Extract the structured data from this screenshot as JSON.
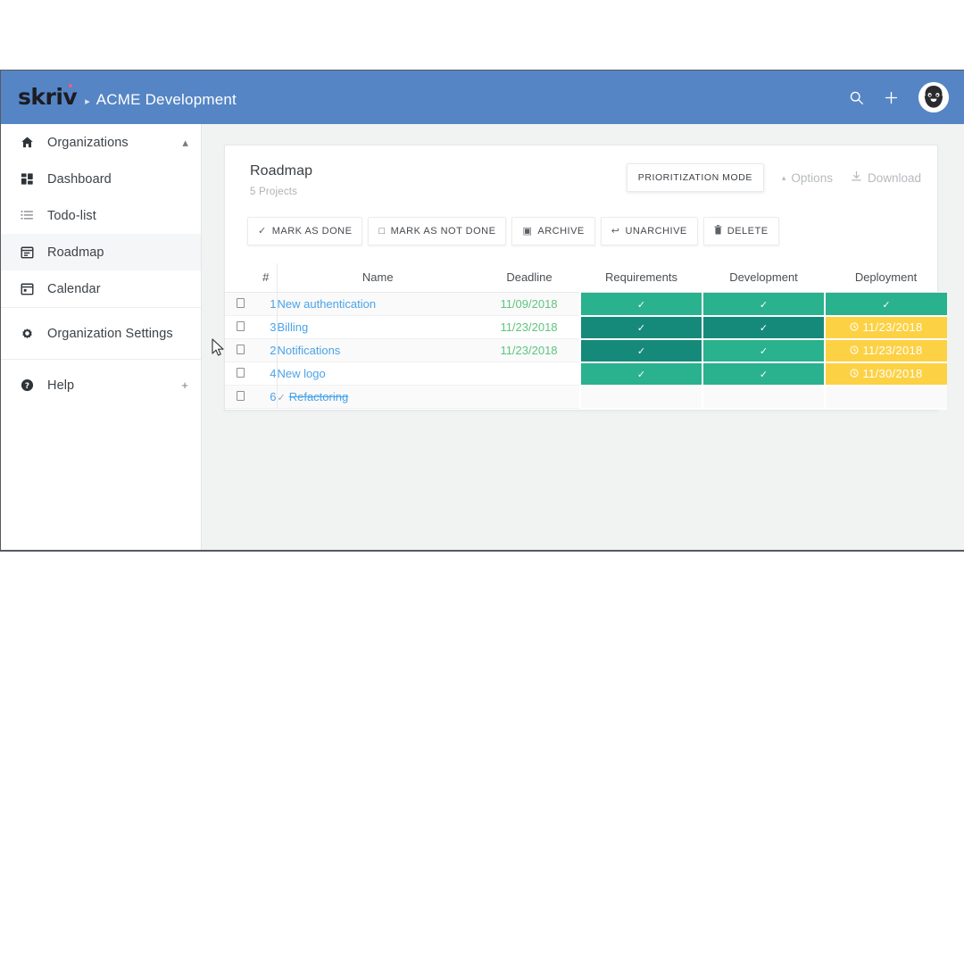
{
  "appbar": {
    "logo_text": "skriv",
    "separator": "▸",
    "org_name": "ACME Development",
    "search_icon": "search-icon",
    "add_icon": "plus-icon",
    "avatar_icon": "user-avatar"
  },
  "sidebar": {
    "groups": [
      {
        "items": [
          {
            "label": "Organizations",
            "icon": "home-icon",
            "trail": "▴",
            "active": false
          },
          {
            "label": "Dashboard",
            "icon": "dashboard-grid-icon",
            "trail": "",
            "active": false
          },
          {
            "label": "Todo-list",
            "icon": "list-icon",
            "trail": "",
            "active": false
          },
          {
            "label": "Roadmap",
            "icon": "roadmap-calendar-icon",
            "trail": "",
            "active": true
          },
          {
            "label": "Calendar",
            "icon": "calendar-icon",
            "trail": "",
            "active": false
          }
        ]
      },
      {
        "items": [
          {
            "label": "Organization Settings",
            "icon": "gear-icon",
            "trail": "",
            "active": false
          }
        ]
      },
      {
        "items": [
          {
            "label": "Help",
            "icon": "help-circle-icon",
            "trail": "+",
            "active": false
          }
        ]
      }
    ]
  },
  "card": {
    "title": "Roadmap",
    "subtitle": "5 Projects",
    "prioritization_button": "PRIORITIZATION MODE",
    "options_link": "Options",
    "options_caret": "▴",
    "download_link": "Download",
    "bulk_actions": [
      {
        "glyph": "✓",
        "label": "MARK AS DONE",
        "icon": "check-icon"
      },
      {
        "glyph": "□",
        "label": "MARK AS NOT DONE",
        "icon": "empty-square-icon"
      },
      {
        "glyph": "▣",
        "label": "ARCHIVE",
        "icon": "archive-icon"
      },
      {
        "glyph": "↩",
        "label": "UNARCHIVE",
        "icon": "unarchive-icon"
      },
      {
        "glyph": "▇",
        "label": "DELETE",
        "icon": "trash-icon"
      }
    ]
  },
  "table": {
    "headers": {
      "number": "#",
      "name": "Name",
      "deadline": "Deadline",
      "stages": [
        "Requirements",
        "Development",
        "Deployment"
      ]
    },
    "rows": [
      {
        "number": "1",
        "name": "New authentication",
        "deadline": "11/09/2018",
        "done": false,
        "stages": [
          {
            "state": "green",
            "text": "✓"
          },
          {
            "state": "green",
            "text": "✓"
          },
          {
            "state": "green",
            "text": "✓"
          }
        ]
      },
      {
        "number": "3",
        "name": "Billing",
        "deadline": "11/23/2018",
        "done": false,
        "stages": [
          {
            "state": "teal",
            "text": "✓"
          },
          {
            "state": "teal",
            "text": "✓"
          },
          {
            "state": "yellow",
            "text": "11/23/2018"
          }
        ]
      },
      {
        "number": "2",
        "name": "Notifications",
        "deadline": "11/23/2018",
        "done": false,
        "stages": [
          {
            "state": "teal",
            "text": "✓"
          },
          {
            "state": "green",
            "text": "✓"
          },
          {
            "state": "yellow",
            "text": "11/23/2018"
          }
        ]
      },
      {
        "number": "4",
        "name": "New logo",
        "deadline": "",
        "done": false,
        "stages": [
          {
            "state": "green",
            "text": "✓"
          },
          {
            "state": "green",
            "text": "✓"
          },
          {
            "state": "yellow",
            "text": "11/30/2018"
          }
        ]
      },
      {
        "number": "6",
        "name": "Refactoring",
        "deadline": "",
        "done": true,
        "stages": [
          {
            "state": "empty",
            "text": ""
          },
          {
            "state": "empty",
            "text": ""
          },
          {
            "state": "empty",
            "text": ""
          }
        ]
      }
    ]
  },
  "colors": {
    "appbar_blue": "#5585c5",
    "stage_green": "#2ab18e",
    "stage_teal": "#168a7a",
    "stage_yellow": "#fcd144",
    "link_blue": "#4aa3e8",
    "deadline_green": "#5fc47f",
    "logo_dot_pink": "#ef5b8c"
  }
}
